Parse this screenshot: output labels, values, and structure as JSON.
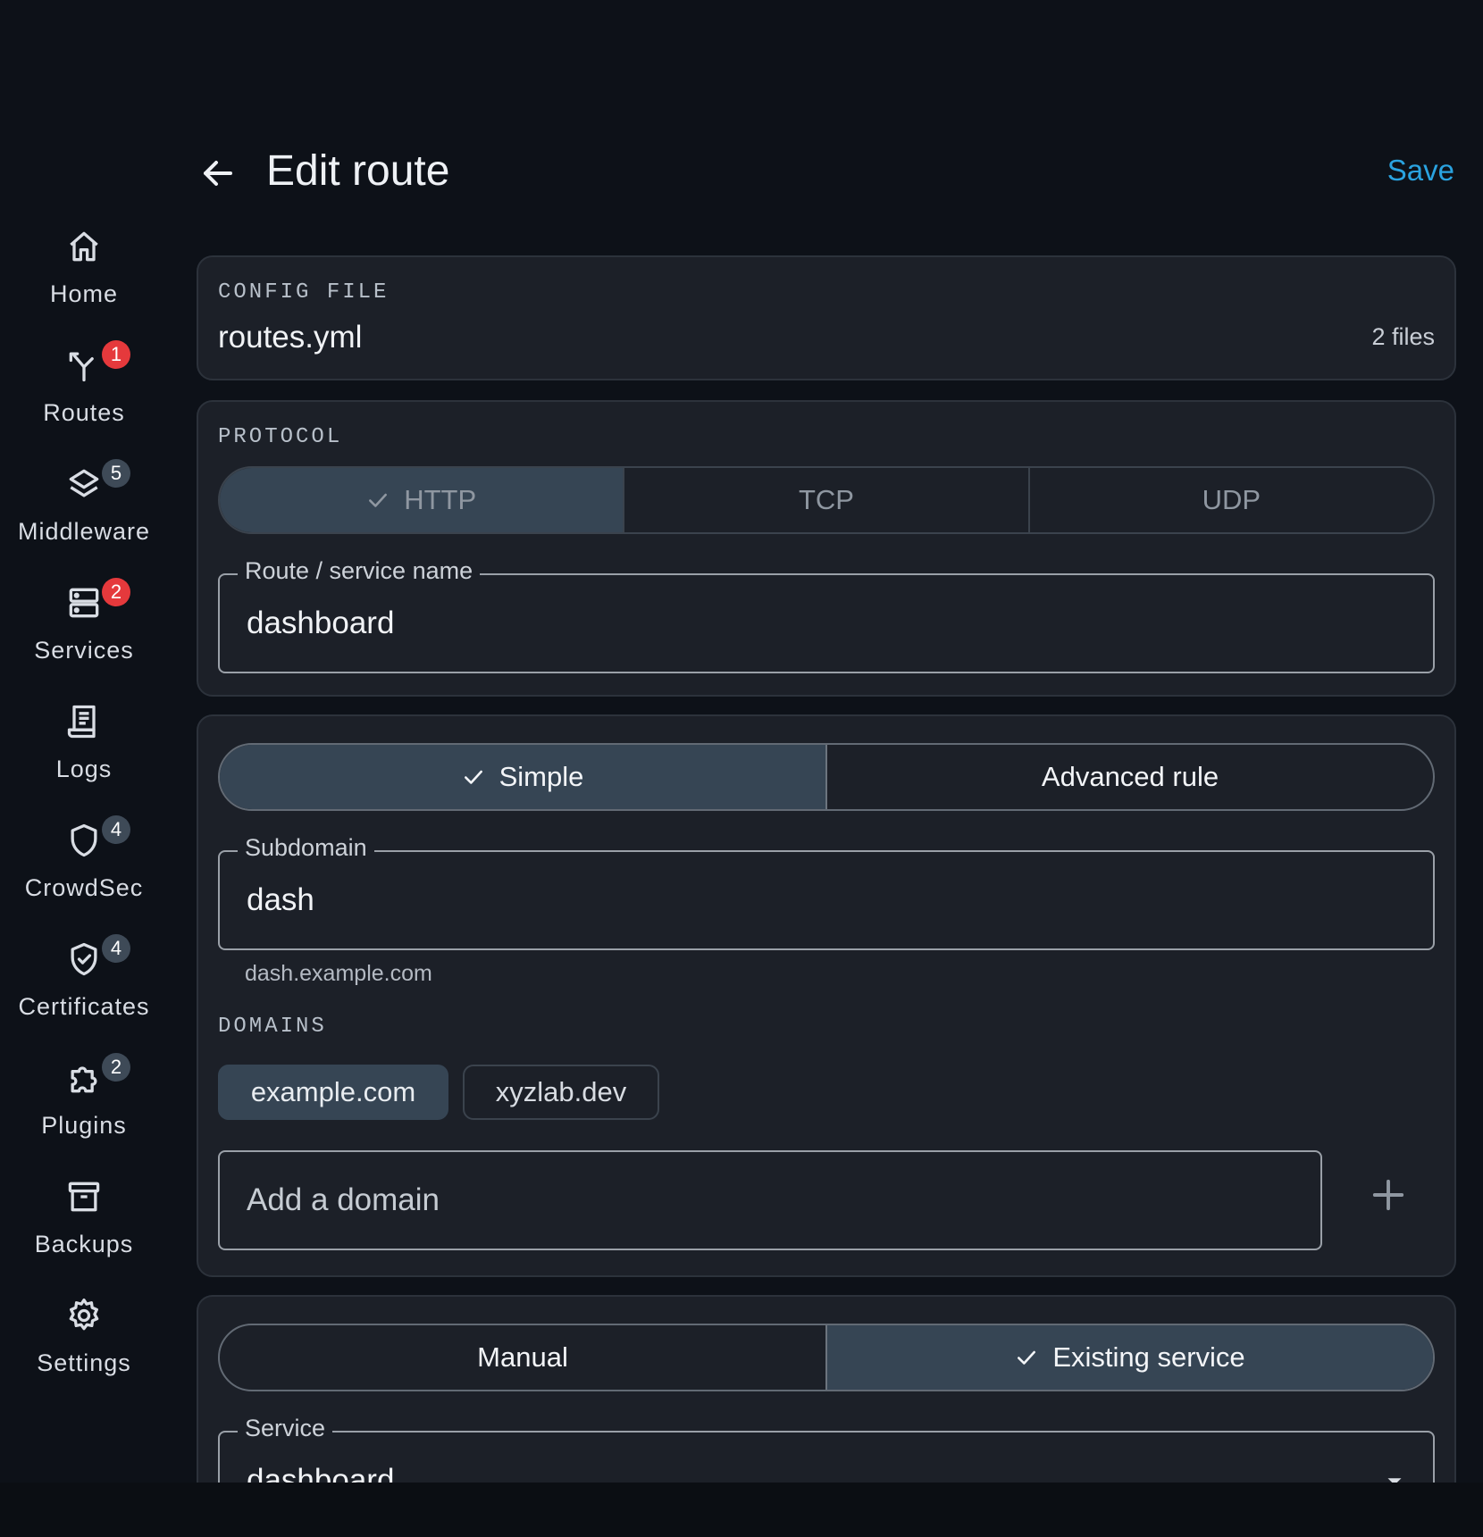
{
  "sidebar": {
    "items": [
      {
        "label": "Home",
        "icon": "home-icon",
        "badge": ""
      },
      {
        "label": "Routes",
        "icon": "routes-icon",
        "badge": "1",
        "badge_color": "#e5393c"
      },
      {
        "label": "Middleware",
        "icon": "layers-icon",
        "badge": "5",
        "badge_color": "#3e4a57"
      },
      {
        "label": "Services",
        "icon": "server-icon",
        "badge": "2",
        "badge_color": "#e5393c"
      },
      {
        "label": "Logs",
        "icon": "receipt-icon",
        "badge": ""
      },
      {
        "label": "CrowdSec",
        "icon": "shield-icon",
        "badge": "4",
        "badge_color": "#3e4a57"
      },
      {
        "label": "Certificates",
        "icon": "shield-check-icon",
        "badge": "4",
        "badge_color": "#3e4a57"
      },
      {
        "label": "Plugins",
        "icon": "puzzle-icon",
        "badge": "2",
        "badge_color": "#3e4a57"
      },
      {
        "label": "Backups",
        "icon": "archive-icon",
        "badge": ""
      },
      {
        "label": "Settings",
        "icon": "gear-icon",
        "badge": ""
      }
    ]
  },
  "header": {
    "title": "Edit route",
    "save_label": "Save",
    "accent_color": "#2aa3e0"
  },
  "config_file": {
    "caption": "CONFIG FILE",
    "name": "routes.yml",
    "count": "2 files"
  },
  "protocol": {
    "caption": "PROTOCOL",
    "options": [
      "HTTP",
      "TCP",
      "UDP"
    ],
    "selected": "HTTP",
    "name_field": {
      "label": "Route / service name",
      "value": "dashboard"
    }
  },
  "rule": {
    "options": [
      "Simple",
      "Advanced rule"
    ],
    "selected": "Simple",
    "subdomain_field": {
      "label": "Subdomain",
      "value": "dash"
    },
    "preview": "dash.example.com",
    "domains_caption": "DOMAINS",
    "domains": [
      "example.com",
      "xyzlab.dev"
    ],
    "selected_domain": "example.com",
    "add_domain_placeholder": "Add a domain"
  },
  "service": {
    "options": [
      "Manual",
      "Existing service"
    ],
    "selected": "Existing service",
    "service_field": {
      "label": "Service",
      "value": "dashboard"
    }
  }
}
